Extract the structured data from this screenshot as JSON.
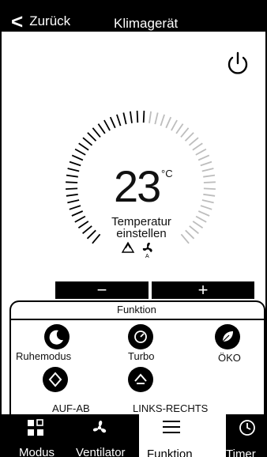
{
  "header": {
    "back_label": "Zurück",
    "title": "Klimagerät"
  },
  "thermostat": {
    "temperature": "23",
    "unit": "°C",
    "label_line1": "Temperatur",
    "label_line2": "einstellen",
    "minus_label": "−",
    "plus_label": "+",
    "tick_level": 0.52
  },
  "functions": {
    "title": "Funktion",
    "items": [
      {
        "label": "Ruhemodus",
        "icon": "moon-icon"
      },
      {
        "label": "Turbo",
        "icon": "gauge-icon"
      },
      {
        "label": "ÖKO",
        "icon": "leaf-icon"
      },
      {
        "label": "AUF-AB",
        "icon": "swing-vertical-icon"
      },
      {
        "label": "LINKS-RECHTS",
        "icon": "swing-horizontal-icon"
      }
    ]
  },
  "nav": {
    "items": [
      {
        "label": "Modus",
        "icon": "grid-icon"
      },
      {
        "label": "Ventilator",
        "icon": "fan-icon"
      },
      {
        "label": "Funktion",
        "icon": "menu-icon"
      },
      {
        "label": "Timer",
        "icon": "clock-icon"
      }
    ],
    "active": "Funktion"
  },
  "colors": {
    "primary": "#000000",
    "background": "#ffffff",
    "tick_inactive": "#bdbdbd"
  }
}
